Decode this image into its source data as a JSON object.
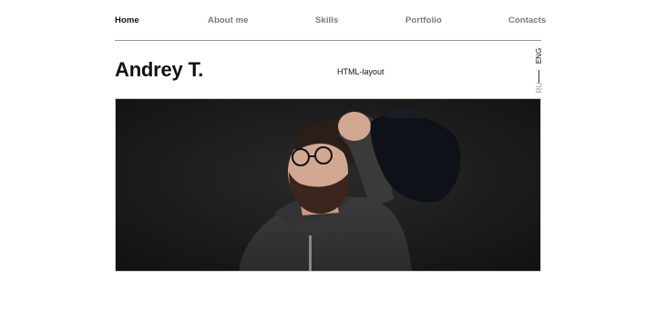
{
  "nav": {
    "items": [
      {
        "label": "Home",
        "active": true
      },
      {
        "label": "About me",
        "active": false
      },
      {
        "label": "Skills",
        "active": false
      },
      {
        "label": "Portfolio",
        "active": false
      },
      {
        "label": "Contacts",
        "active": false
      }
    ]
  },
  "header": {
    "name": "Andrey T.",
    "subtitle": "HTML-layout"
  },
  "lang": {
    "eng": "ENG",
    "ru": "RU"
  },
  "hero": {
    "alt_icon": "portrait-photo"
  }
}
